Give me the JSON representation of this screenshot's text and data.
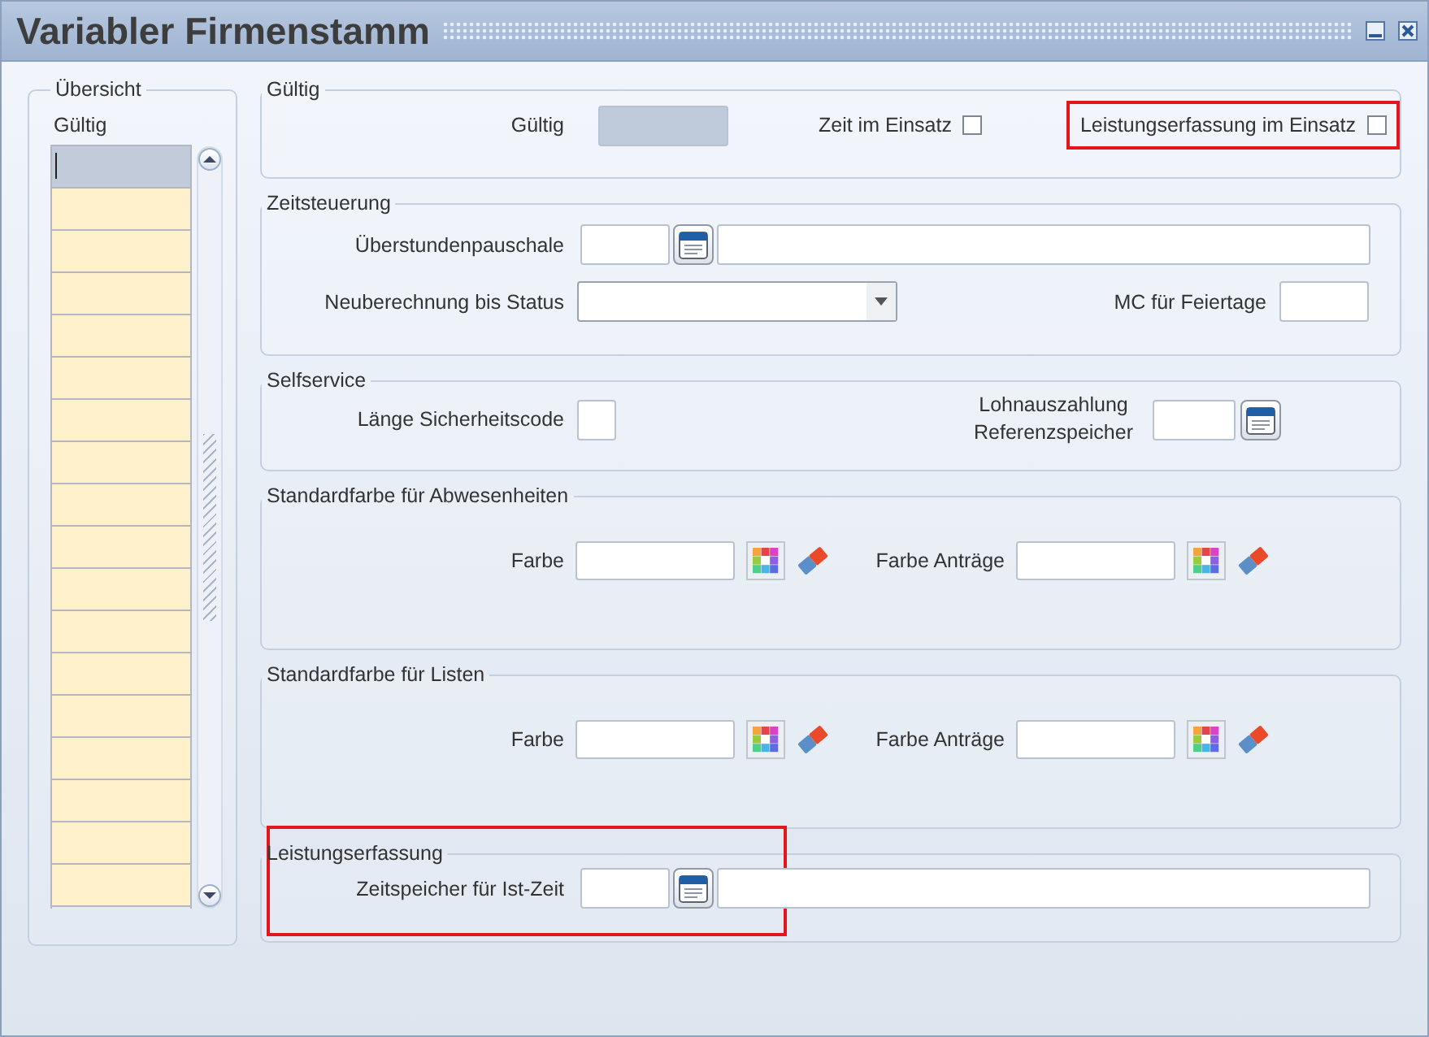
{
  "window": {
    "title": "Variabler Firmenstamm"
  },
  "overview": {
    "legend": "Übersicht",
    "column": "Gültig",
    "rows": [
      {
        "selected": true
      },
      {
        "selected": false
      },
      {
        "selected": false
      },
      {
        "selected": false
      },
      {
        "selected": false
      },
      {
        "selected": false
      },
      {
        "selected": false
      },
      {
        "selected": false
      },
      {
        "selected": false
      },
      {
        "selected": false
      },
      {
        "selected": false
      },
      {
        "selected": false
      },
      {
        "selected": false
      },
      {
        "selected": false
      },
      {
        "selected": false
      },
      {
        "selected": false
      },
      {
        "selected": false
      },
      {
        "selected": false
      }
    ]
  },
  "validity": {
    "legend": "Gültig",
    "field": {
      "label": "Gültig",
      "disabled": true
    },
    "checkboxes": [
      {
        "label": "Zeit im Einsatz",
        "checked": false,
        "highlighted": false
      },
      {
        "label": "Leistungserfassung im Einsatz",
        "checked": false,
        "highlighted": true
      }
    ]
  },
  "time_control": {
    "legend": "Zeitsteuerung",
    "overtime": {
      "label": "Überstundenpauschale"
    },
    "recalc": {
      "label": "Neuberechnung bis Status"
    },
    "holidays": {
      "label": "MC für Feiertage"
    }
  },
  "selfservice": {
    "legend": "Selfservice",
    "code_length": {
      "label": "Länge Sicherheitscode"
    },
    "payout": {
      "label": "Lohnauszahlung Referenzspeicher"
    }
  },
  "color_sections": [
    {
      "legend": "Standardfarbe für Abwesenheiten",
      "fields": [
        {
          "label": "Farbe"
        },
        {
          "label": "Farbe Anträge"
        }
      ]
    },
    {
      "legend": "Standardfarbe für Listen",
      "fields": [
        {
          "label": "Farbe"
        },
        {
          "label": "Farbe Anträge"
        }
      ]
    }
  ],
  "performance": {
    "legend": "Leistungserfassung",
    "highlighted": true,
    "field": {
      "label": "Zeitspeicher für Ist-Zeit"
    }
  }
}
